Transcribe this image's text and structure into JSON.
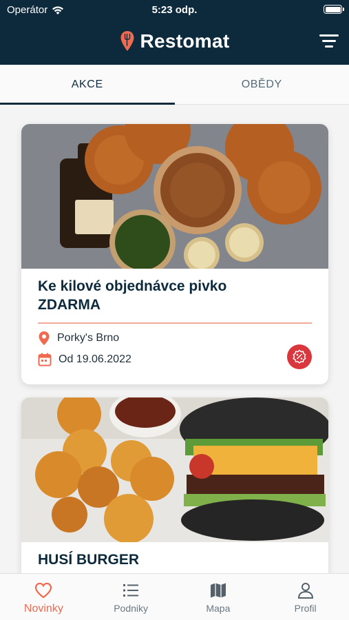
{
  "status_bar": {
    "carrier": "Operátor",
    "time": "5:23 odp."
  },
  "header": {
    "title": "Restomat"
  },
  "tabs": [
    {
      "label": "AKCE",
      "active": true
    },
    {
      "label": "OBĚDY",
      "active": false
    }
  ],
  "cards": [
    {
      "title_line1": "Ke kilové objednávce pivko",
      "title_line2": "ZDARMA",
      "place": "Porky's Brno",
      "date": "Od 19.06.2022",
      "badge_icon": "discount-icon"
    },
    {
      "title_line1": "HUSÍ BURGER"
    }
  ],
  "bottom_nav": [
    {
      "label": "Novinky",
      "icon": "heart-icon",
      "active": true
    },
    {
      "label": "Podniky",
      "icon": "list-icon",
      "active": false
    },
    {
      "label": "Mapa",
      "icon": "map-icon",
      "active": false
    },
    {
      "label": "Profil",
      "icon": "person-icon",
      "active": false
    }
  ],
  "colors": {
    "brand": "#0d2a3d",
    "accent": "#ef6a4f",
    "badge": "#d9363e"
  }
}
